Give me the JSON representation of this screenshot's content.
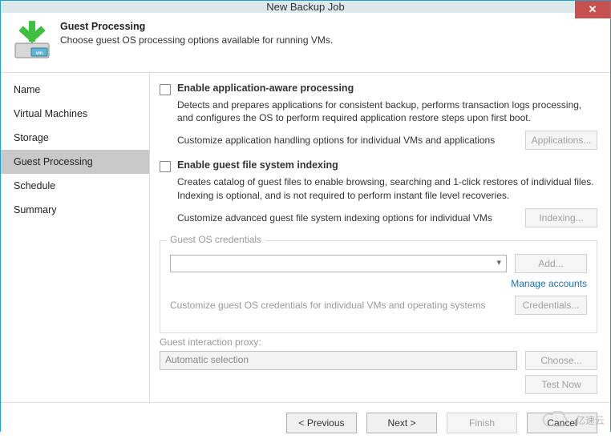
{
  "window": {
    "title": "New Backup Job"
  },
  "header": {
    "title": "Guest Processing",
    "subtitle": "Choose guest OS processing options available for running VMs."
  },
  "sidebar": {
    "items": [
      {
        "label": "Name",
        "active": false
      },
      {
        "label": "Virtual Machines",
        "active": false
      },
      {
        "label": "Storage",
        "active": false
      },
      {
        "label": "Guest Processing",
        "active": true
      },
      {
        "label": "Schedule",
        "active": false
      },
      {
        "label": "Summary",
        "active": false
      }
    ]
  },
  "section_app": {
    "check_label": "Enable application-aware processing",
    "desc": "Detects and prepares applications for consistent backup, performs transaction logs processing, and configures the OS to perform required application restore steps upon first boot.",
    "customize_text": "Customize application handling options for individual VMs and applications",
    "button": "Applications..."
  },
  "section_index": {
    "check_label": "Enable guest file system indexing",
    "desc": "Creates catalog of guest files to enable browsing, searching and 1-click restores of individual files. Indexing is optional, and is not required to perform instant file level recoveries.",
    "customize_text": "Customize advanced guest file system indexing options for individual VMs",
    "button": "Indexing..."
  },
  "credentials": {
    "legend": "Guest OS credentials",
    "dropdown_value": "",
    "add_button": "Add...",
    "manage_link": "Manage accounts",
    "customize_text": "Customize guest OS credentials for individual VMs and operating systems",
    "credentials_button": "Credentials..."
  },
  "proxy": {
    "label": "Guest interaction proxy:",
    "value": "Automatic selection",
    "choose_button": "Choose...",
    "test_button": "Test Now"
  },
  "footer": {
    "previous": "< Previous",
    "next": "Next >",
    "finish": "Finish",
    "cancel": "Cancel"
  },
  "watermark": {
    "text": "亿速云"
  }
}
